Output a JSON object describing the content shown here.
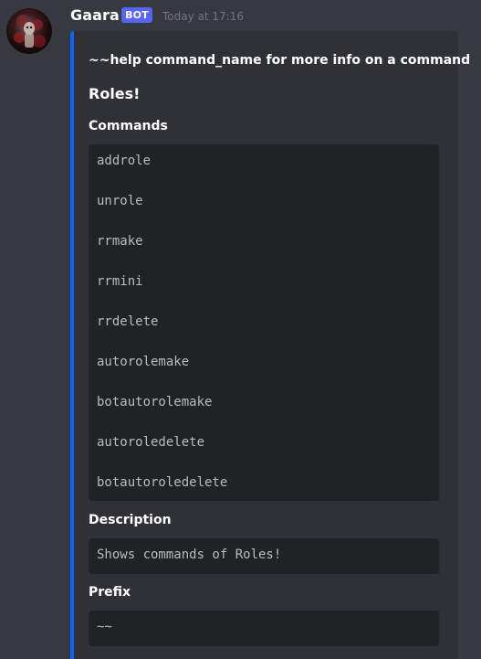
{
  "author": {
    "name": "Gaara",
    "tag": "BOT",
    "timestamp": "Today at 17:16"
  },
  "embed": {
    "accent_color": "#0d64ff",
    "help_line": "~~help command_name for more info on a command",
    "title": "Roles!",
    "fields": {
      "commands": {
        "name": "Commands",
        "items": [
          "addrole",
          "unrole",
          "rrmake",
          "rrmini",
          "rrdelete",
          "autorolemake",
          "botautorolemake",
          "autoroledelete",
          "botautoroledelete"
        ]
      },
      "description": {
        "name": "Description",
        "value": "Shows commands of Roles!"
      },
      "prefix": {
        "name": "Prefix",
        "value": "~~"
      }
    }
  }
}
